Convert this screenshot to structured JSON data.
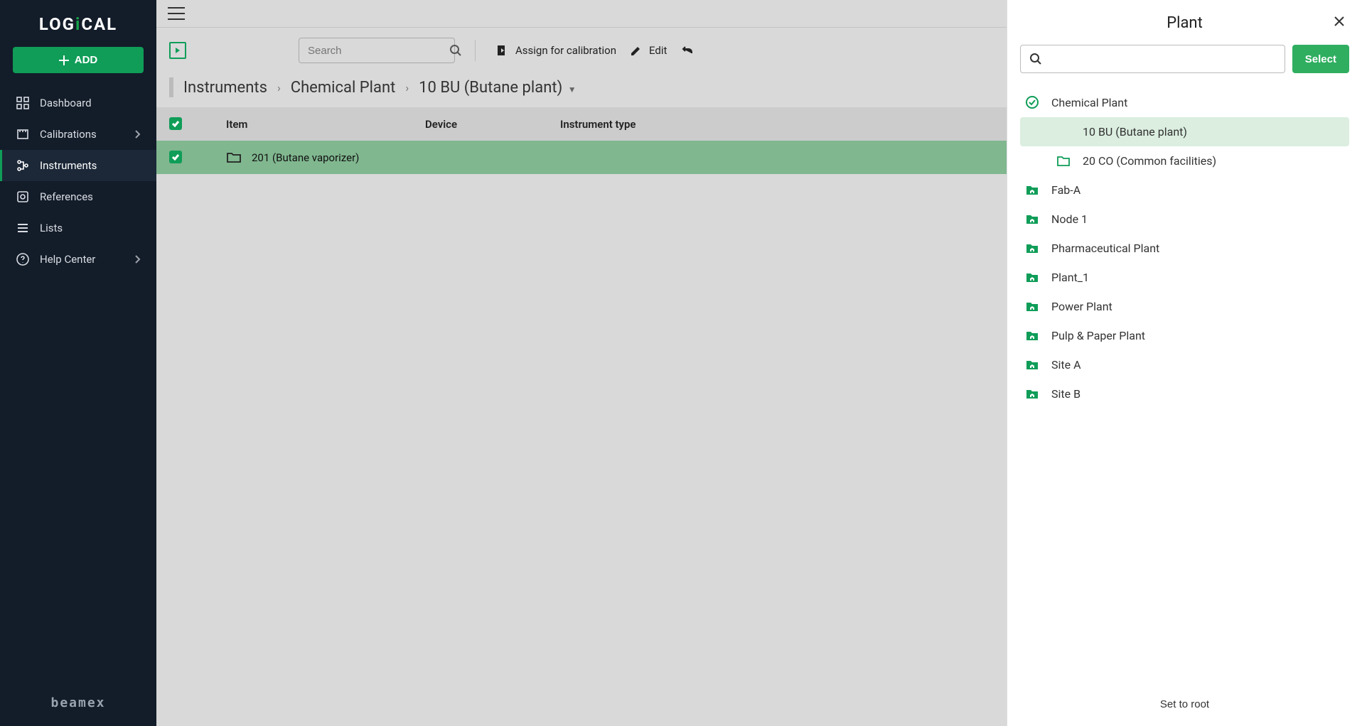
{
  "sidebar": {
    "logo_prefix": "LOG",
    "logo_i": "i",
    "logo_suffix": "CAL",
    "add_label": "ADD",
    "items": [
      {
        "label": "Dashboard",
        "icon": "dashboard"
      },
      {
        "label": "Calibrations",
        "icon": "calibration",
        "chev": true
      },
      {
        "label": "Instruments",
        "icon": "instruments",
        "active": true
      },
      {
        "label": "References",
        "icon": "references"
      },
      {
        "label": "Lists",
        "icon": "lists"
      },
      {
        "label": "Help Center",
        "icon": "help",
        "chev": true
      }
    ],
    "footer_brand": "beamex"
  },
  "main": {
    "search_placeholder": "Search",
    "assign_label": "Assign for calibration",
    "edit_label": "Edit",
    "breadcrumb": {
      "level1": "Instruments",
      "level2": "Chemical Plant",
      "level3": "10 BU (Butane plant)"
    },
    "table": {
      "headers": {
        "item": "Item",
        "device": "Device",
        "type": "Instrument type"
      },
      "rows": [
        {
          "name": "201 (Butane vaporizer)"
        }
      ]
    }
  },
  "panel": {
    "title": "Plant",
    "select_label": "Select",
    "search_placeholder": "",
    "tree": [
      {
        "label": "Chemical Plant",
        "icon": "check-circle",
        "level": 0
      },
      {
        "label": "10 BU (Butane plant)",
        "icon": "none",
        "level": 1,
        "highlight": true
      },
      {
        "label": "20 CO (Common facilities)",
        "icon": "folder-outline",
        "level": 1
      },
      {
        "label": "Fab-A",
        "icon": "home-folder",
        "level": 0
      },
      {
        "label": "Node 1",
        "icon": "home-folder",
        "level": 0
      },
      {
        "label": "Pharmaceutical Plant",
        "icon": "home-folder",
        "level": 0
      },
      {
        "label": "Plant_1",
        "icon": "home-folder",
        "level": 0
      },
      {
        "label": "Power Plant",
        "icon": "home-folder",
        "level": 0
      },
      {
        "label": "Pulp & Paper Plant",
        "icon": "home-folder",
        "level": 0
      },
      {
        "label": "Site A",
        "icon": "home-folder",
        "level": 0
      },
      {
        "label": "Site B",
        "icon": "home-folder",
        "level": 0
      }
    ],
    "set_root_label": "Set to root"
  }
}
